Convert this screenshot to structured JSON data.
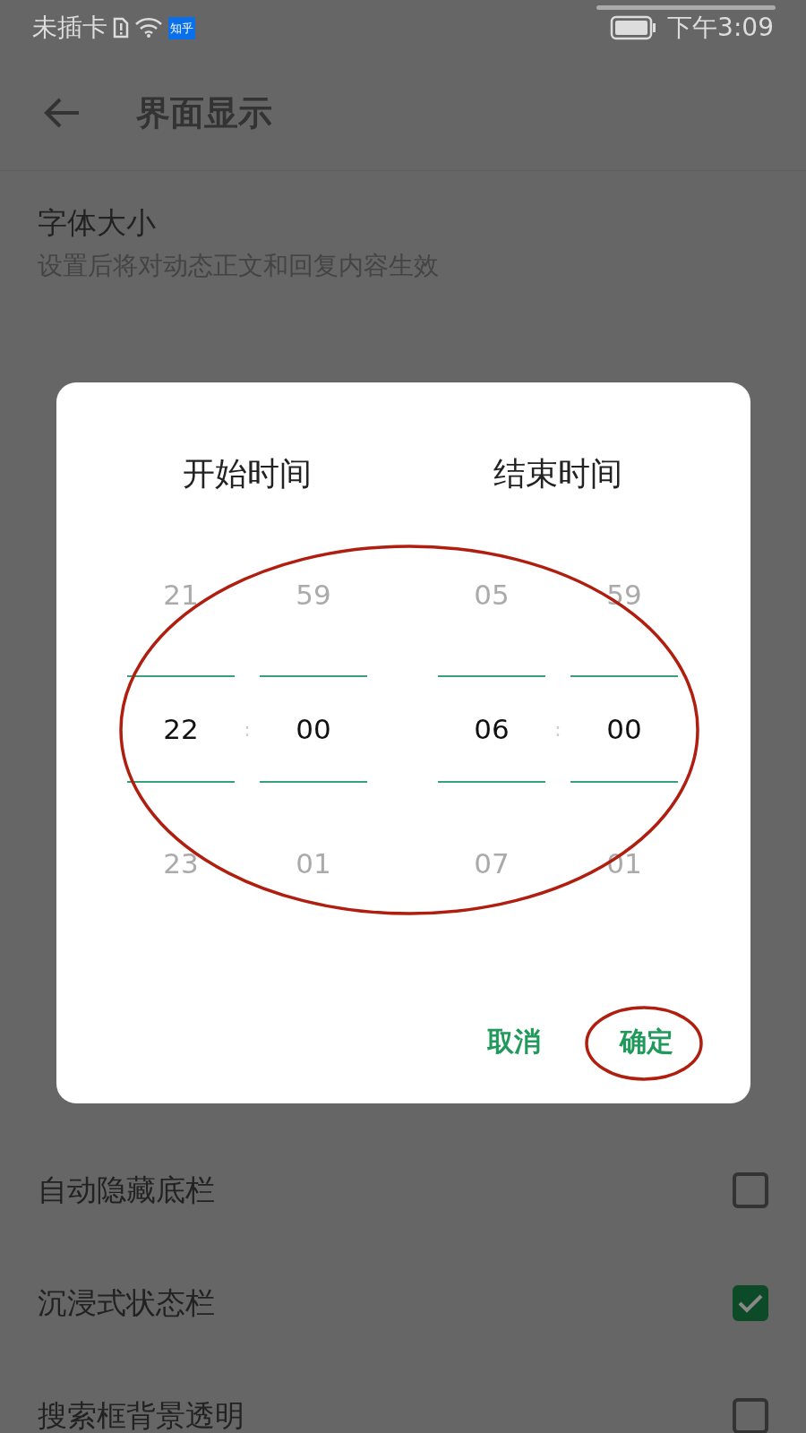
{
  "status_bar": {
    "carrier": "未插卡",
    "app_badge": "知乎",
    "time": "下午3:09"
  },
  "top_bar": {
    "title": "界面显示"
  },
  "settings": [
    {
      "title": "字体大小",
      "subtitle": "设置后将对动态正文和回复内容生效"
    }
  ],
  "lower_settings": [
    {
      "kind": "checkbox",
      "title": "自动隐藏底栏",
      "checked": false
    },
    {
      "kind": "checkbox",
      "title": "沉浸式状态栏",
      "checked": true
    },
    {
      "kind": "checkbox",
      "title": "搜索框背景透明",
      "checked": false
    }
  ],
  "dialog": {
    "pickers": [
      {
        "heading": "开始时间",
        "separator": ":",
        "columns": [
          {
            "above": "21",
            "value": "22",
            "below": "23"
          },
          {
            "above": "59",
            "value": "00",
            "below": "01"
          }
        ]
      },
      {
        "heading": "结束时间",
        "separator": ":",
        "columns": [
          {
            "above": "05",
            "value": "06",
            "below": "07"
          },
          {
            "above": "59",
            "value": "00",
            "below": "01"
          }
        ]
      }
    ],
    "buttons": [
      {
        "label": "取消"
      },
      {
        "label": "确定"
      }
    ]
  },
  "annotations": [
    {
      "kind": "ellipse"
    },
    {
      "kind": "ellipse"
    }
  ]
}
